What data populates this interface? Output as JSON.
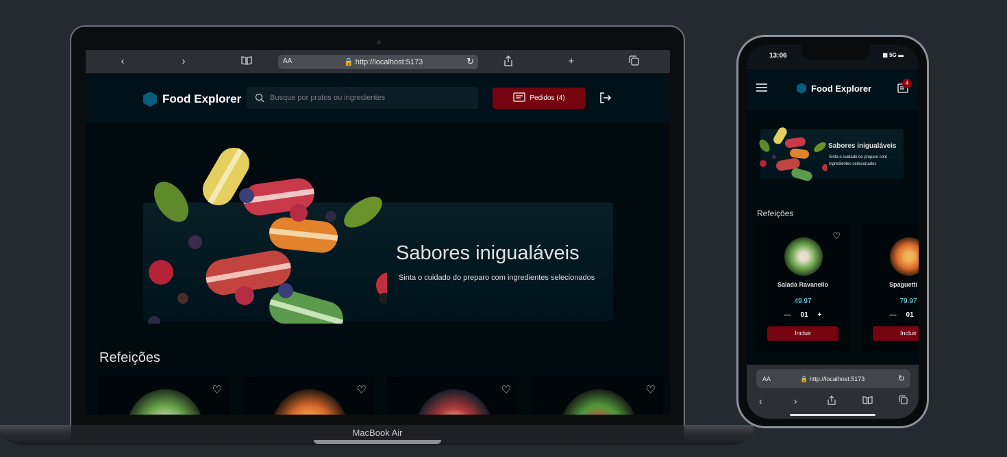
{
  "laptop": {
    "base_label": "MacBook Air",
    "browser": {
      "aa": "AA",
      "url": "http://localhost:5173"
    },
    "header": {
      "logo": "Food Explorer",
      "search_placeholder": "Busque por pratos ou ingredientes",
      "orders": "Pedidos (4)"
    },
    "hero": {
      "title": "Sabores inigualáveis",
      "subtitle": "Sinta o cuidado do preparo com ingredientes selecionados"
    },
    "section_title": "Refeições"
  },
  "phone": {
    "time": "13:06",
    "signal": "5G",
    "logo": "Food Explorer",
    "badge": "4",
    "hero": {
      "title": "Sabores inigualáveis",
      "subtitle": "Sinta o cuidado do preparo com ingredientes selecionados"
    },
    "section_title": "Refeições",
    "cards": [
      {
        "name": "Salada Ravanello",
        "price": "49.97",
        "qty": "01",
        "button": "Incluir"
      },
      {
        "name": "Spaguetti Go",
        "price": "79.97",
        "qty": "01",
        "button": "Incluir"
      }
    ],
    "browser": {
      "aa": "AA",
      "url": "http://localhost:5173"
    }
  },
  "colors": {
    "background": "#242a2f",
    "header": "#00111a",
    "accent_red": "#750310",
    "price_cyan": "#82f3ff",
    "logo_hex": "#065e7c"
  }
}
